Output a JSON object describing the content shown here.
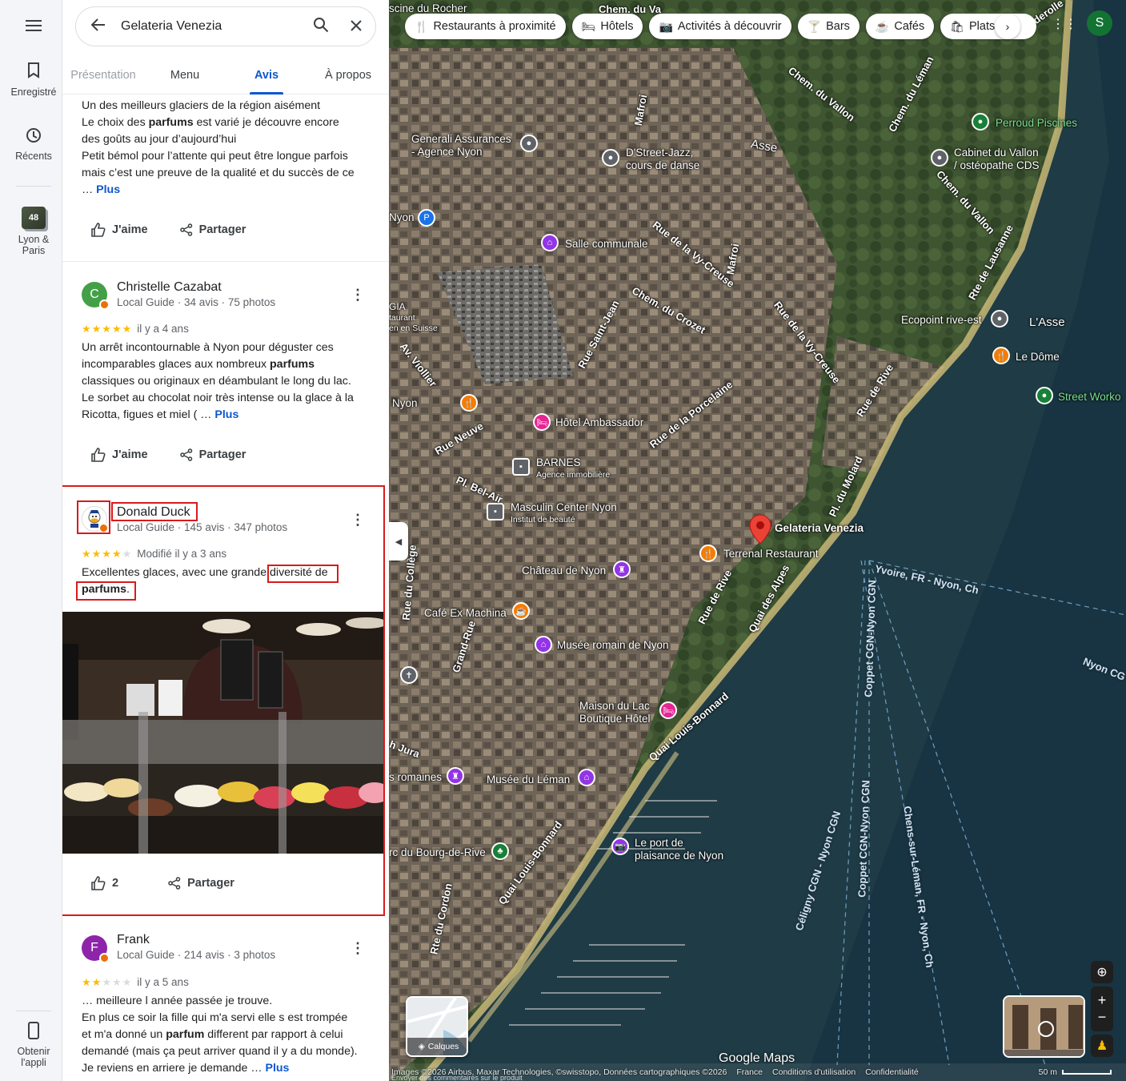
{
  "rail": {
    "saved": "Enregistré",
    "recent": "Récents",
    "collection_count": "48",
    "collection_label_1": "Lyon &",
    "collection_label_2": "Paris",
    "get_app_1": "Obtenir",
    "get_app_2": "l'appli"
  },
  "search": {
    "query": "Gelateria Venezia"
  },
  "tabs": [
    "Présentation",
    "Menu",
    "Avis",
    "À propos"
  ],
  "active_tab": "Avis",
  "review0": {
    "line1": "Un des meilleurs glaciers de la région aisément",
    "line2a": "Le choix des ",
    "line2b": "parfums",
    "line2c": " est varié je découvre encore",
    "line3": "des goûts au jour d’aujourd’hui",
    "line4": "Petit bémol pour l’attente qui peut être longue parfois",
    "line5": "mais c’est une preuve de la qualité et du succès de ce",
    "ellipsis": "… ",
    "more": "Plus",
    "like": "J'aime",
    "share": "Partager"
  },
  "review1": {
    "initial": "C",
    "name": "Christelle Cazabat",
    "meta": "Local Guide · 34 avis · 75 photos",
    "rating": 5,
    "time": "il y a 4 ans",
    "line1": "Un arrêt incontournable à Nyon pour déguster ces",
    "line2a": "incomparables glaces aux nombreux ",
    "line2b": "parfums",
    "line3": "classiques ou originaux en déambulant le long du lac.",
    "line4": "Le sorbet au chocolat noir très intense ou la glace à la",
    "line5": "Ricotta, figues et miel ( … ",
    "more": "Plus",
    "like": "J'aime",
    "share": "Partager"
  },
  "review2": {
    "name": "Donald Duck",
    "meta": "Local Guide · 145 avis · 347 photos",
    "rating": 4,
    "time": "Modifié il y a 3 ans",
    "line1a": "Excellentes glaces, avec une grande ",
    "line1b": "diversité de",
    "line2a": "parfums",
    "line2b": ".",
    "likes": "2",
    "share": "Partager"
  },
  "review3": {
    "initial": "F",
    "name": "Frank",
    "meta": "Local Guide · 214 avis · 3 photos",
    "rating": 2,
    "time": "il y a 5 ans",
    "line1": "… meilleure l année passée je trouve.",
    "line2": "En plus ce soir la fille qui m'a servi elle s est trompée",
    "line3a": "et m'a donné un ",
    "line3b": "parfum",
    "line3c": " different par rapport à celui",
    "line4": "demandé (mais ça peut arriver quand il y a du monde).",
    "line5": "Je reviens en arriere je demande … ",
    "more": "Plus"
  },
  "chips": [
    "Restaurants à proximité",
    "Hôtels",
    "Activités à découvrir",
    "Bars",
    "Cafés",
    "Plats à e"
  ],
  "map": {
    "account_initial": "S",
    "layers": "Calques",
    "pois": {
      "gelateria": "Gelateria Venezia",
      "terrenal": "Terrenal Restaurant",
      "chateau": "Château de Nyon",
      "cafe": "Café Ex Machina",
      "musee_romain": "Musée romain de Nyon",
      "maison_1": "Maison du Lac",
      "maison_2": "Boutique Hôtel",
      "musee_leman": "Musée du Léman",
      "port_1": "Le port de",
      "port_2": "plaisance de Nyon",
      "ambassador": "Hôtel Ambassador",
      "barnes": "BARNES",
      "barnes_sub": "Agence immobilière",
      "masculin": "Masculin Center Nyon",
      "masculin_sub": "Institut de beauté",
      "salle": "Salle communale",
      "generali_1": "Generali Assurances",
      "generali_2": "- Agence Nyon",
      "dstreet_1": "D'Street-Jazz,",
      "dstreet_2": "cours de danse",
      "cabinet_1": "Cabinet du Vallon",
      "cabinet_2": "/ ostéopathe CDS",
      "perroud": "Perroud Piscines",
      "ecopoint": "Ecopoint rive-est",
      "dome": "Le Dôme",
      "asse": "L'Asse",
      "asse2": "Asse",
      "street_workout": "Street Worko",
      "nyon_left": "Nyon",
      "nyon_left2": "Nyon",
      "romaines": "s romaines",
      "bourg": "rc du Bourg-de-Rive",
      "piscine": "scine du Rocher",
      "gia_1": "GIA",
      "gia_2": "taurant",
      "gia_3": "en en Suisse"
    },
    "streets": {
      "vallon1": "Chem. du Vallon",
      "vallon2": "Chem. du Vallon",
      "leman": "Chem. du Léman",
      "lausanne": "Rte de Lausanne",
      "vy_creuse1": "Rue de la Vy-Creuse",
      "vy_creuse2": "Rue de la Vy-Creuse",
      "crozet": "Chem. du Crozet",
      "saint_jean": "Rue Saint-Jean",
      "porcelaine": "Rue de la Porcelaine",
      "rive": "Rue de Rive",
      "rive2": "Rue de Rive",
      "molard": "Pl. du Molard",
      "alpes": "Quai des Alpes",
      "bonnard1": "Quai Louis-Bonnard",
      "bonnard2": "Quai Louis-Bonnard",
      "viollier": "Av. Viollier",
      "neuve": "Rue Neuve",
      "bel_air": "Pl. Bel-Air",
      "college": "Rue du Collège",
      "grand_rue": "Grand-Rue",
      "jura": "h Jura",
      "cordon": "Rte du Cordon",
      "mafroi1": "Mafroi",
      "mafroi2": "Mafroi",
      "banderolle": "Banderolle",
      "chem_du_va": "Chem. du Va"
    },
    "ferries": {
      "yvoire": "Yvoire, FR - Nyon, Ch",
      "coppet1": "Coppet CGN-Nyon CGN",
      "coppet2": "Coppet CGN-Nyon CGN",
      "celigny": "Céligny CGN - Nyon CGN",
      "chens": "Chens-sur-Léman, FR - Nyon, Ch",
      "nyon_cg": "Nyon CG"
    },
    "footer": {
      "images": "Images ©2026 Airbus, Maxar Technologies, ©swisstopo, Données cartographiques ©2026",
      "france": "France",
      "conditions": "Conditions d'utilisation",
      "privacy": "Confidentialité",
      "scale": "50 m",
      "logo": "Google Maps",
      "feedback": "Envoyer des commentaires sur le produit"
    }
  },
  "colors": {
    "accent": "#0b57d0",
    "star": "#fbbc04",
    "highlight": "#d81b1b",
    "avatar_c": "#43a047",
    "avatar_f": "#8e24aa",
    "pin_red": "#ea4335"
  }
}
